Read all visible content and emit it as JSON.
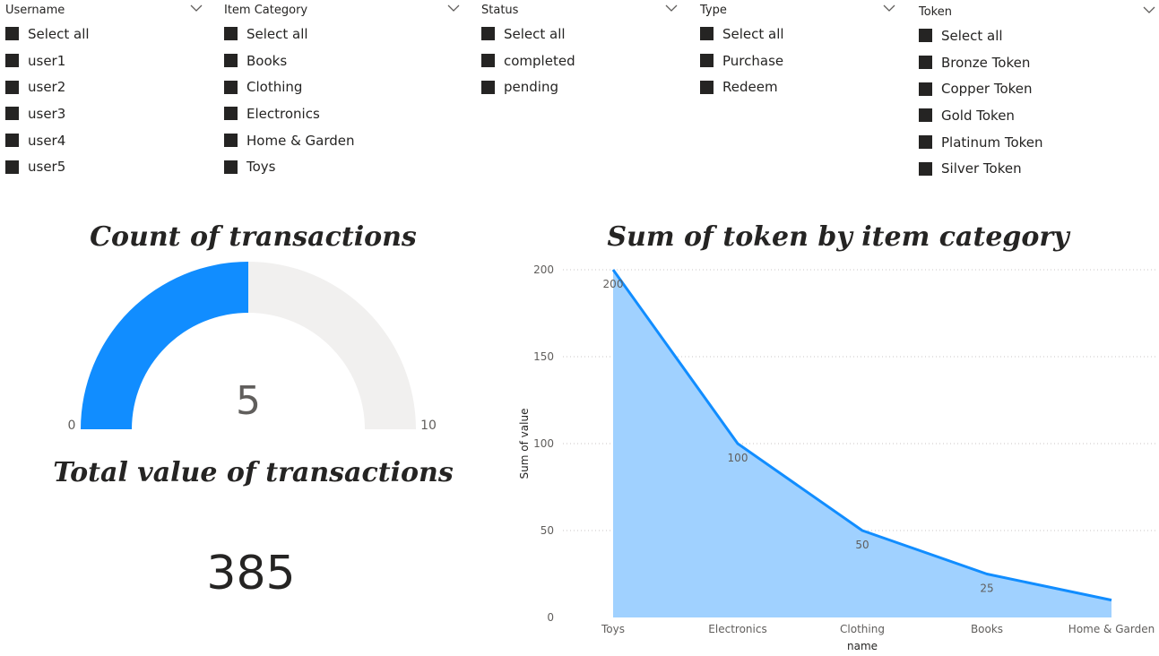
{
  "slicers": [
    {
      "title": "Username",
      "items": [
        "Select all",
        "user1",
        "user2",
        "user3",
        "user4",
        "user5"
      ]
    },
    {
      "title": "Item Category",
      "items": [
        "Select all",
        "Books",
        "Clothing",
        "Electronics",
        "Home & Garden",
        "Toys"
      ]
    },
    {
      "title": "Status",
      "items": [
        "Select all",
        "completed",
        "pending"
      ]
    },
    {
      "title": "Type",
      "items": [
        "Select all",
        "Purchase",
        "Redeem"
      ]
    },
    {
      "title": "Token",
      "items": [
        "Select all",
        "Bronze Token",
        "Copper Token",
        "Gold Token",
        "Platinum Token",
        "Silver Token"
      ]
    }
  ],
  "gauge": {
    "title": "Count of transactions",
    "value": 5,
    "min": 0,
    "max": 10,
    "value_label": "5",
    "min_label": "0",
    "max_label": "10",
    "fill_color": "#118DFF",
    "track_color": "#F1F0EF"
  },
  "card": {
    "title": "Total value of transactions",
    "value": "385"
  },
  "chart_data": {
    "type": "area",
    "title": "Sum of token by item category",
    "xlabel": "name",
    "ylabel": "Sum of value",
    "categories": [
      "Toys",
      "Electronics",
      "Clothing",
      "Books",
      "Home & Garden"
    ],
    "values": [
      200,
      100,
      50,
      25,
      10
    ],
    "data_labels": [
      "200",
      "100",
      "50",
      "25",
      ""
    ],
    "ylim": [
      0,
      200
    ],
    "yticks": [
      0,
      50,
      100,
      150,
      200
    ],
    "grid": true,
    "line_color": "#118DFF",
    "fill_color": "#A0D1FF"
  }
}
